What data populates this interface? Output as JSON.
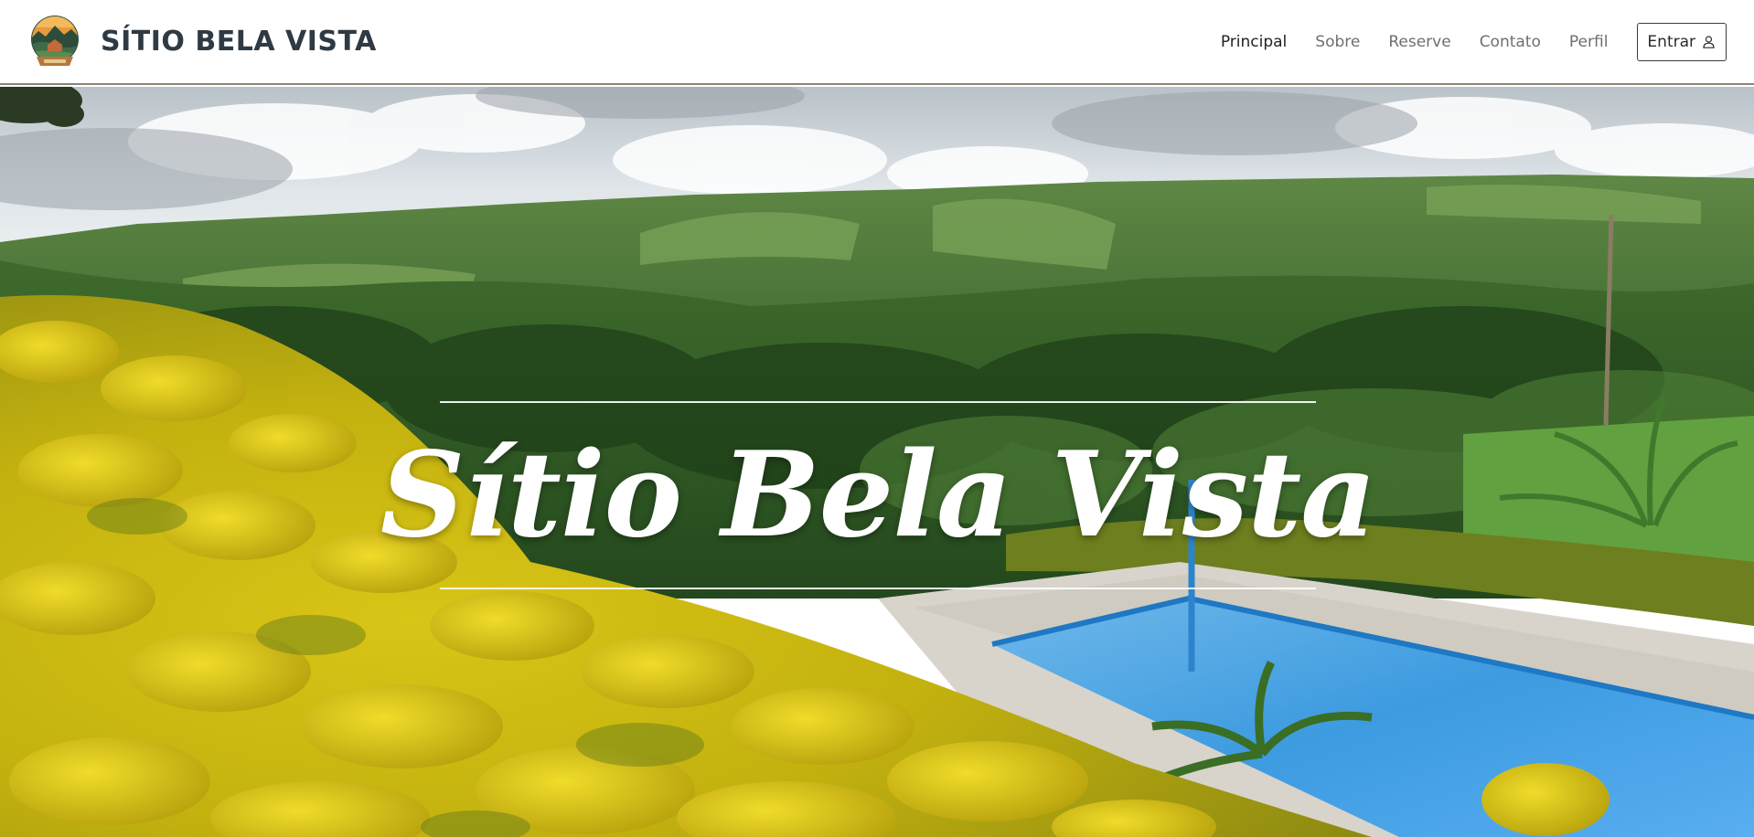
{
  "brand": {
    "name": "SÍTIO BELA VISTA",
    "logo_icon": "farm-landscape-logo-icon"
  },
  "nav": {
    "items": [
      {
        "label": "Principal",
        "active": true
      },
      {
        "label": "Sobre",
        "active": false
      },
      {
        "label": "Reserve",
        "active": false
      },
      {
        "label": "Contato",
        "active": false
      },
      {
        "label": "Perfil",
        "active": false
      }
    ],
    "login": {
      "label": "Entrar",
      "icon": "user-icon"
    }
  },
  "hero": {
    "title": "Sítio Bela Vista",
    "background": "countryside-valley-with-pool-photo"
  },
  "colors": {
    "brand_text": "#2e3a44",
    "nav_active": "#222222",
    "nav_inactive": "#6f6f6f",
    "header_border": "#8a8378"
  }
}
